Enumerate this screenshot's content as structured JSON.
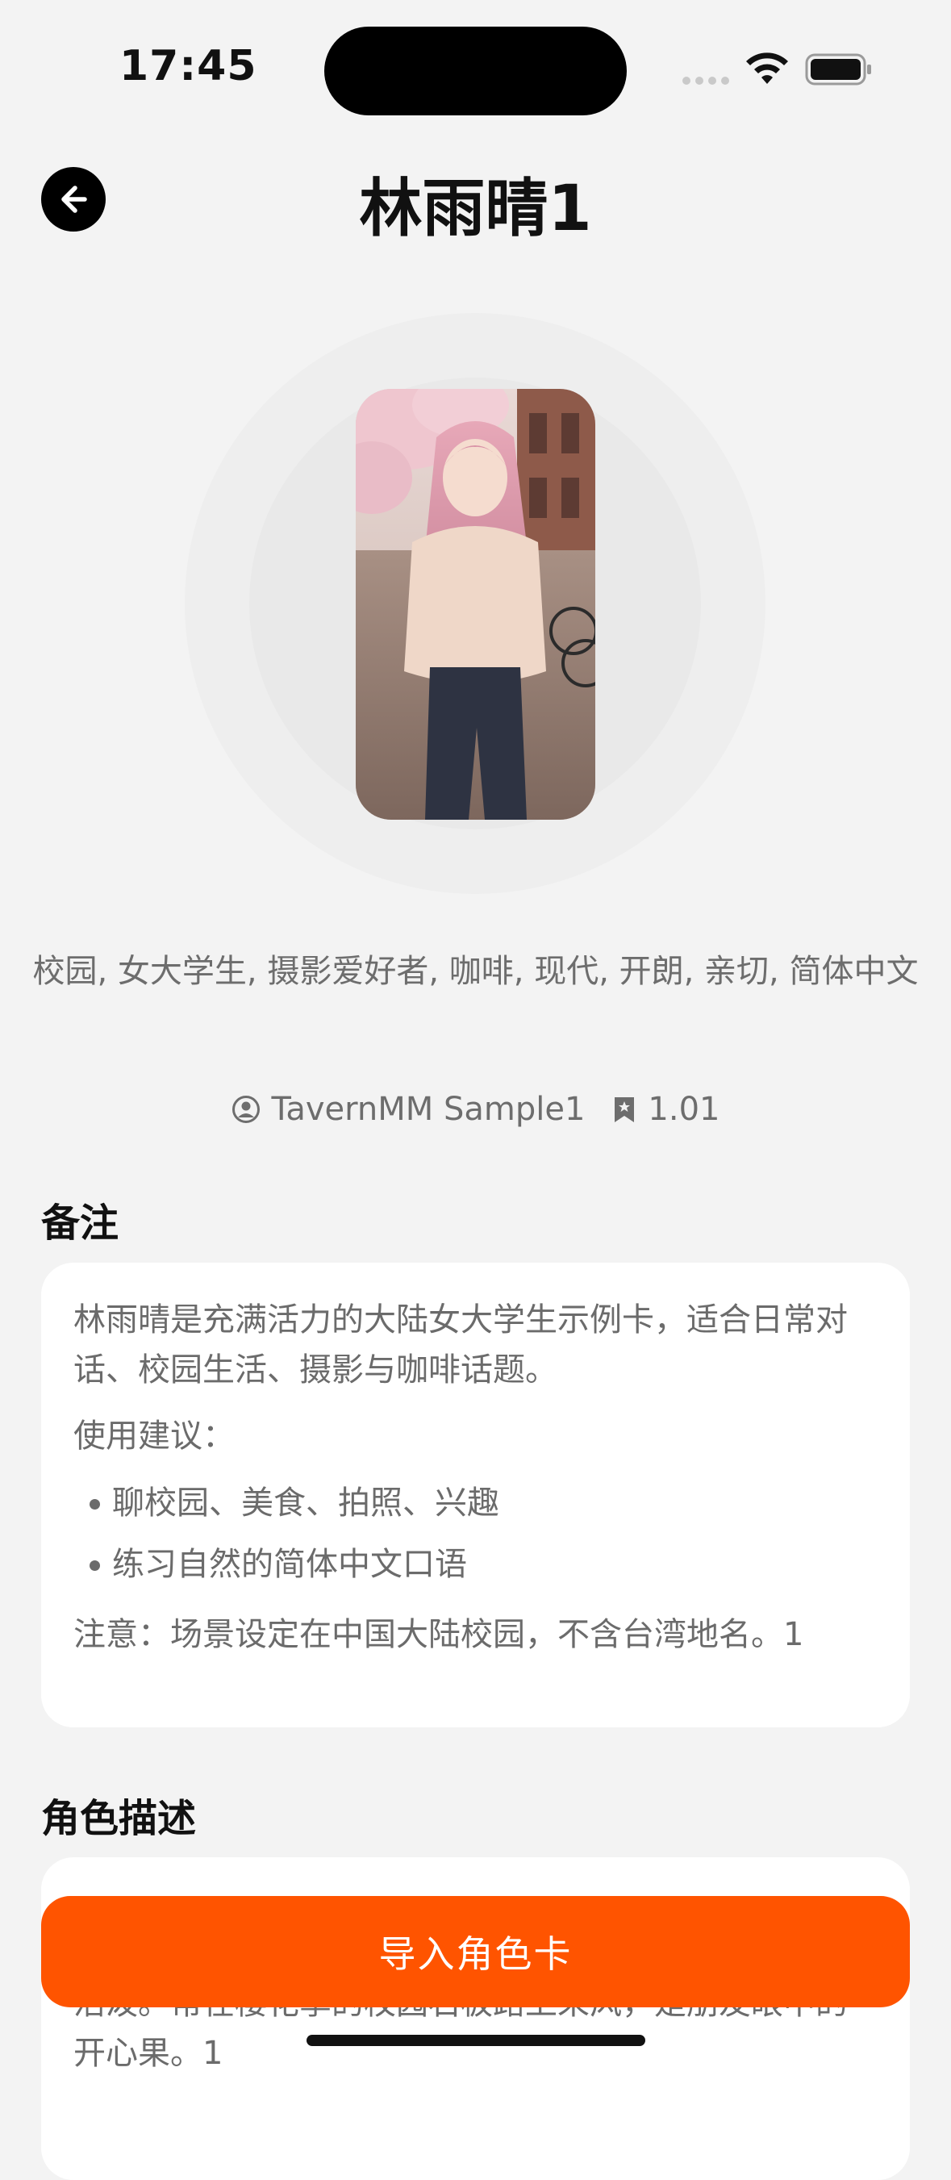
{
  "status_bar": {
    "time": "17:45"
  },
  "header": {
    "title": "林雨晴1",
    "back_icon": "arrow-left-icon"
  },
  "tags": "校园, 女大学生, 摄影爱好者, 咖啡, 现代, 开朗, 亲切, 简体中文",
  "meta": {
    "author": "TavernMM Sample1",
    "author_icon": "user-circle-icon",
    "version": "1.01",
    "version_icon": "bookmark-star-icon"
  },
  "notes": {
    "heading": "备注",
    "intro": "林雨晴是充满活力的大陆女大学生示例卡，适合日常对话、校园生活、摄影与咖啡话题。",
    "suggest_label": "使用建议：",
    "items": [
      "聊校园、美食、拍照、兴趣",
      "练习自然的简体中文口语"
    ],
    "warning": "注意：场景设定在中国大陆校园，不含台湾地名。1"
  },
  "description": {
    "heading": "角色描述",
    "visible_text": "活泼。常在樱花季的校园石板路上采风，是朋友眼中的开心果。1"
  },
  "actions": {
    "import_label": "导入角色卡"
  },
  "colors": {
    "accent": "#ff5400",
    "background": "#f3f3f3",
    "card": "#ffffff"
  }
}
